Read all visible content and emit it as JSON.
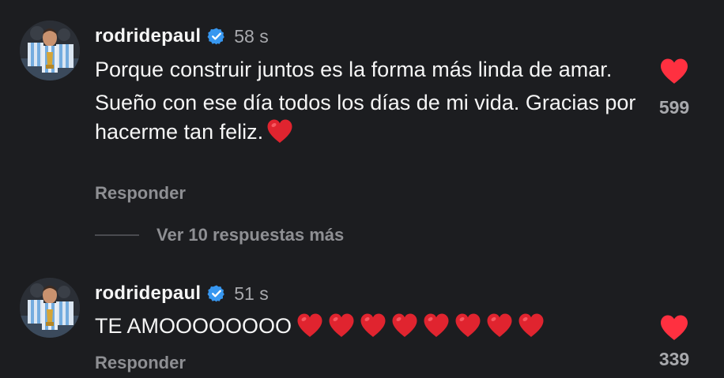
{
  "comments": [
    {
      "username": "rodridepaul",
      "timestamp": "58 s",
      "paragraphs": [
        "Porque construir juntos es la forma más linda de amar.",
        "Sueño con ese día todos los días de mi vida. Gracias por hacerme tan feliz."
      ],
      "emoji": "red-heart",
      "reply_label": "Responder",
      "like_count": "599",
      "liked": true
    },
    {
      "username": "rodridepaul",
      "timestamp": "51 s",
      "text": "TE AMOOOOOOOO",
      "emoji_count": 8,
      "reply_label": "Responder",
      "like_count": "339",
      "liked": true
    }
  ],
  "view_replies_label": "Ver 10 respuestas más",
  "colors": {
    "background": "#1c1d20",
    "like_red": "#ff3040",
    "verified_blue": "#3797f0",
    "muted_text": "#a8a9ad"
  },
  "icons": {
    "avatar": "avatar",
    "verified": "verified-badge-icon",
    "like": "heart-filled-icon",
    "emoji": "red-heart-emoji"
  }
}
